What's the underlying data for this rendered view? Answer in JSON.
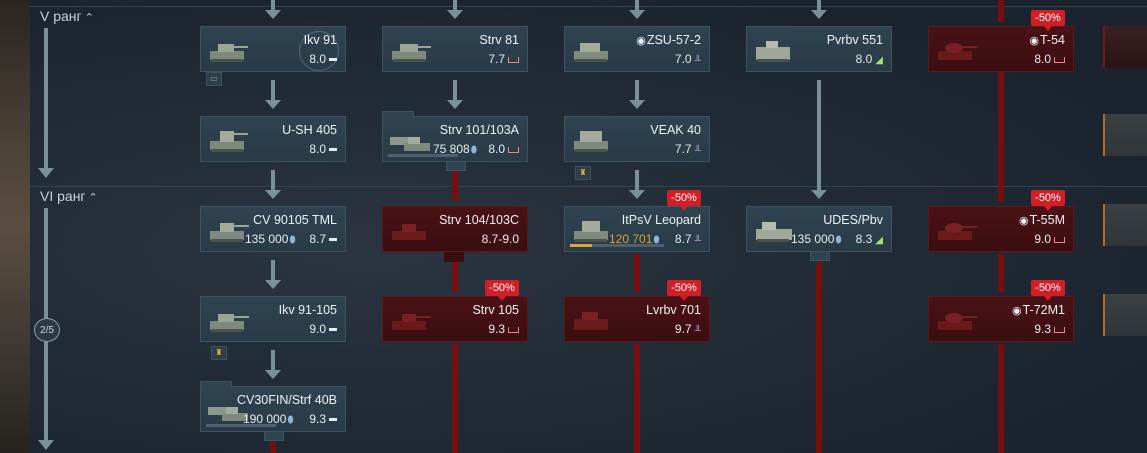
{
  "ranks": [
    {
      "label": "V ранг",
      "chevron": "^"
    },
    {
      "label": "VI ранг",
      "chevron": "^"
    }
  ],
  "progress": "2/5",
  "discount": "-50%",
  "vehicles": [
    {
      "id": "ikv91",
      "name": "Ikv 91",
      "br": "8.0",
      "type": "light-tank"
    },
    {
      "id": "strv81",
      "name": "Strv 81",
      "br": "7.7",
      "type": "medium-tank"
    },
    {
      "id": "zsu572",
      "name": "ZSU-57-2",
      "br": "7.0",
      "type": "spaa",
      "marker": "◉"
    },
    {
      "id": "pvrbv551",
      "name": "Pvrbv 551",
      "br": "8.0",
      "type": "tank-destroyer"
    },
    {
      "id": "t54",
      "name": "T-54",
      "br": "8.0",
      "type": "medium-tank",
      "marker": "◉",
      "discount": "-50%"
    },
    {
      "id": "ush405",
      "name": "U-SH 405",
      "br": "8.0",
      "type": "light-tank"
    },
    {
      "id": "strv101",
      "name": "Strv 101/103A",
      "br": "8.0",
      "cost": "75 808",
      "type": "medium-tank"
    },
    {
      "id": "veak40",
      "name": "VEAK 40",
      "br": "7.7",
      "type": "spaa"
    },
    {
      "id": "cv90105",
      "name": "CV 90105 TML",
      "br": "8.7",
      "cost": "135 000",
      "type": "light-tank"
    },
    {
      "id": "strv104",
      "name": "Strv 104/103C",
      "br": "8.7-9.0"
    },
    {
      "id": "itpsv",
      "name": "ItPsV Leopard",
      "br": "8.7",
      "cost": "120 701",
      "type": "spaa",
      "discount": "-50%"
    },
    {
      "id": "udes",
      "name": "UDES/Pbv",
      "br": "8.3",
      "cost": "135 000",
      "type": "tank-destroyer"
    },
    {
      "id": "t55m",
      "name": "T-55M",
      "br": "9.0",
      "type": "medium-tank",
      "marker": "◉",
      "discount": "-50%"
    },
    {
      "id": "ikv91105",
      "name": "Ikv 91-105",
      "br": "9.0",
      "type": "light-tank"
    },
    {
      "id": "strv105",
      "name": "Strv 105",
      "br": "9.3",
      "type": "medium-tank",
      "discount": "-50%"
    },
    {
      "id": "lvrbv701",
      "name": "Lvrbv 701",
      "br": "9.7",
      "type": "spaa",
      "discount": "-50%"
    },
    {
      "id": "t72m1",
      "name": "T-72M1",
      "br": "9.3",
      "type": "medium-tank",
      "marker": "◉",
      "discount": "-50%"
    },
    {
      "id": "cv30fin",
      "name": "CV30FIN/Strf 40B",
      "br": "9.3",
      "cost": "190 000",
      "type": "light-tank"
    }
  ],
  "colors": {
    "accent": "#e8a32f",
    "discount": "#d11f28",
    "researched_line": "#7a9297",
    "locked_line": "#7a0e0e"
  }
}
